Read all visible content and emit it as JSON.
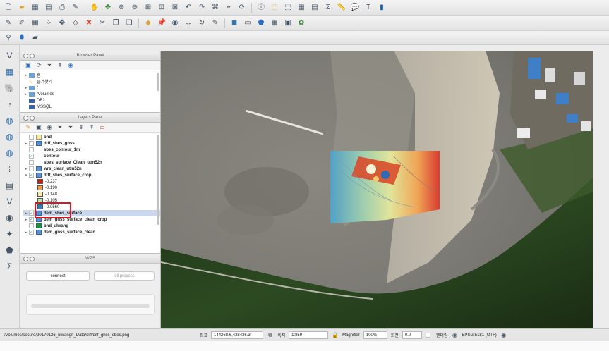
{
  "toolbar1": {
    "icons": [
      "new-icon",
      "open-icon",
      "save-icon",
      "save-as-icon",
      "print-icon",
      "compose-icon",
      "pan-icon",
      "pan-to-selection-icon",
      "zoom-in-icon",
      "zoom-out-icon",
      "zoom-full-icon",
      "zoom-layer-icon",
      "zoom-selection-icon",
      "zoom-last-icon",
      "zoom-next-icon",
      "new-bookmark-icon",
      "bookmarks-icon",
      "refresh-icon",
      "identify-icon",
      "select-icon",
      "deselect-icon",
      "attribute-table-icon",
      "field-calc-icon",
      "statistics-icon",
      "measure-icon",
      "map-tips-icon",
      "annotation-icon",
      "help-icon"
    ]
  },
  "toolbar2": {
    "icons": [
      "edit-pencil-icon",
      "digitize-icon",
      "save-edits-icon",
      "add-point-icon",
      "move-feature-icon",
      "node-tool-icon",
      "delete-icon",
      "cut-icon",
      "copy-icon",
      "paste-icon",
      "label-icon",
      "pin-label-icon",
      "show-hide-label-icon",
      "move-label-icon",
      "rotate-label-icon",
      "change-label-icon",
      "python-icon",
      "text-annotation-icon",
      "plugin-icon",
      "grid-icon",
      "raster-calc-icon",
      "grass-icon"
    ]
  },
  "toolbar3": {
    "icons": [
      "gps-icon",
      "db-icon",
      "shell-icon"
    ]
  },
  "left_tools": {
    "icons": [
      "add-vector-icon",
      "add-raster-icon",
      "add-postgis-icon",
      "add-spatialite-icon",
      "add-wms-icon",
      "add-wcs-icon",
      "add-wfs-icon",
      "add-delimited-icon",
      "add-virtual-icon",
      "add-oracle-icon",
      "add-mssql-icon",
      "new-shapefile-icon",
      "add-db2-icon",
      "sum-icon"
    ]
  },
  "browser_panel": {
    "title": "Browser Panel",
    "items": [
      {
        "label": "홈"
      },
      {
        "label": "즐겨찾기"
      },
      {
        "label": "/"
      },
      {
        "label": "/Volumes"
      },
      {
        "label": "DB2"
      },
      {
        "label": "MSSQL"
      }
    ]
  },
  "layers_panel": {
    "title": "Layers Panel",
    "layers": [
      {
        "name": "bnd",
        "checked": false,
        "bold": true
      },
      {
        "name": "diff_sbes_gnss",
        "checked": false,
        "bold": true
      },
      {
        "name": "sbes_contour_1m",
        "checked": false,
        "bold": true
      },
      {
        "name": "contour",
        "checked": true,
        "bold": true
      },
      {
        "name": "sbes_surface_Clean_utm52n",
        "checked": false,
        "bold": true
      },
      {
        "name": "wrs_clean_utm52n",
        "checked": false,
        "bold": true
      },
      {
        "name": "diff_sbes_surface_crop",
        "checked": true,
        "bold": true
      }
    ],
    "legend": [
      {
        "label": "-0.237",
        "color": "#c0201c"
      },
      {
        "label": "-0.190",
        "color": "#f19a4a"
      },
      {
        "label": "-0.148",
        "color": "#fde9a1"
      },
      {
        "label": "-0.105",
        "color": "#c2e3b6"
      },
      {
        "label": "-0.0560",
        "color": "#2c7fbf"
      }
    ],
    "layers_after": [
      {
        "name": "dem_sbes_surface",
        "checked": true,
        "selected": true
      },
      {
        "name": "dem_gnss_surface_clean_crop",
        "checked": true,
        "selected": false
      },
      {
        "name": "bnd_ulwang",
        "checked": false,
        "selected": false
      },
      {
        "name": "dem_gnss_surface_clean",
        "checked": true,
        "selected": false
      }
    ]
  },
  "wps_panel": {
    "title": "WPS",
    "connect_label": "connect",
    "kill_label": "kill process"
  },
  "status_bar": {
    "path": "/Volumes/secure/20170126_ulwangri_Data/diff/diff_gnss_sbes.png",
    "coord_label": "좌표",
    "coord_value": "144268.6,438436.3",
    "scale_label": "축척",
    "scale_value": "1:859",
    "magnifier_label": "Magnifier",
    "magnifier_value": "100%",
    "rotation_label": "회전",
    "rotation_value": "0.0",
    "render_label": "렌더링",
    "crs": "EPSG:5181 (OTF)"
  }
}
